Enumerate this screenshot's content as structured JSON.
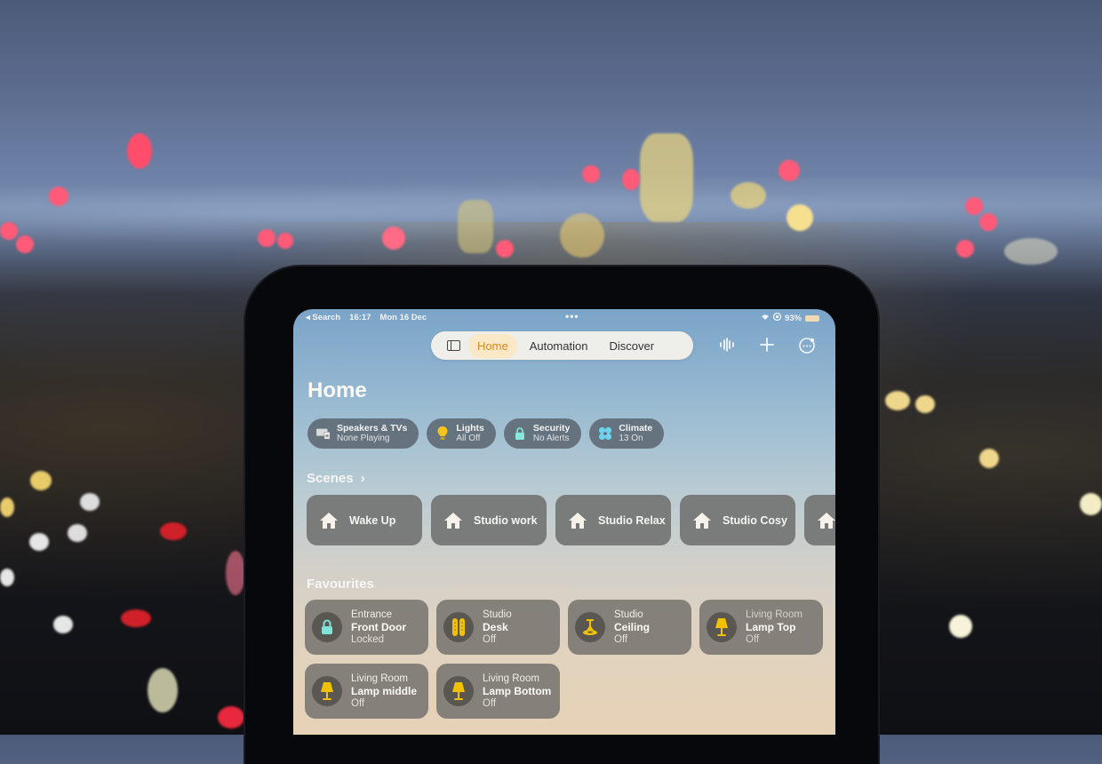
{
  "status_bar": {
    "back_label": "◂ Search",
    "time": "16:17",
    "date": "Mon 16 Dec",
    "multitask_dots": "•••",
    "battery": "93%"
  },
  "nav": {
    "tabs": [
      {
        "label": "Home",
        "active": true
      },
      {
        "label": "Automation",
        "active": false
      },
      {
        "label": "Discover",
        "active": false
      }
    ],
    "icons": [
      "sidebar-icon",
      "voice-waveform-icon",
      "add-icon",
      "more-icon"
    ]
  },
  "page_title": "Home",
  "chips": [
    {
      "title": "Speakers & TVs",
      "subtitle": "None Playing",
      "icon": "speakers-tv-icon"
    },
    {
      "title": "Lights",
      "subtitle": "All Off",
      "icon": "lightbulb-icon"
    },
    {
      "title": "Security",
      "subtitle": "No Alerts",
      "icon": "lock-icon"
    },
    {
      "title": "Climate",
      "subtitle": "13 On",
      "icon": "fan-icon"
    }
  ],
  "scenes": {
    "heading": "Scenes",
    "chevron": "›",
    "items": [
      {
        "label": "Wake Up"
      },
      {
        "label": "Studio work"
      },
      {
        "label": "Studio Relax"
      },
      {
        "label": "Studio Cosy"
      },
      {
        "label": ""
      }
    ]
  },
  "favourites": {
    "heading": "Favourites",
    "items": [
      {
        "room": "Entrance",
        "name": "Front Door",
        "state": "Locked",
        "icon": "lock-icon"
      },
      {
        "room": "Studio",
        "name": "Desk",
        "state": "Off",
        "icon": "light-strip-icon"
      },
      {
        "room": "Studio",
        "name": "Ceiling",
        "state": "Off",
        "icon": "ceiling-lamp-icon"
      },
      {
        "room": "Living Room",
        "name": "Lamp Top",
        "state": "Off",
        "icon": "table-lamp-icon"
      },
      {
        "room": "Living Room",
        "name": "Lamp middle",
        "state": "Off",
        "icon": "table-lamp-icon"
      },
      {
        "room": "Living Room",
        "name": "Lamp Bottom",
        "state": "Off",
        "icon": "table-lamp-icon"
      }
    ]
  },
  "colors": {
    "active_tab": "#e08a1e",
    "accessory_yellow": "#f2c200",
    "lock_teal": "#7fe3d6"
  }
}
